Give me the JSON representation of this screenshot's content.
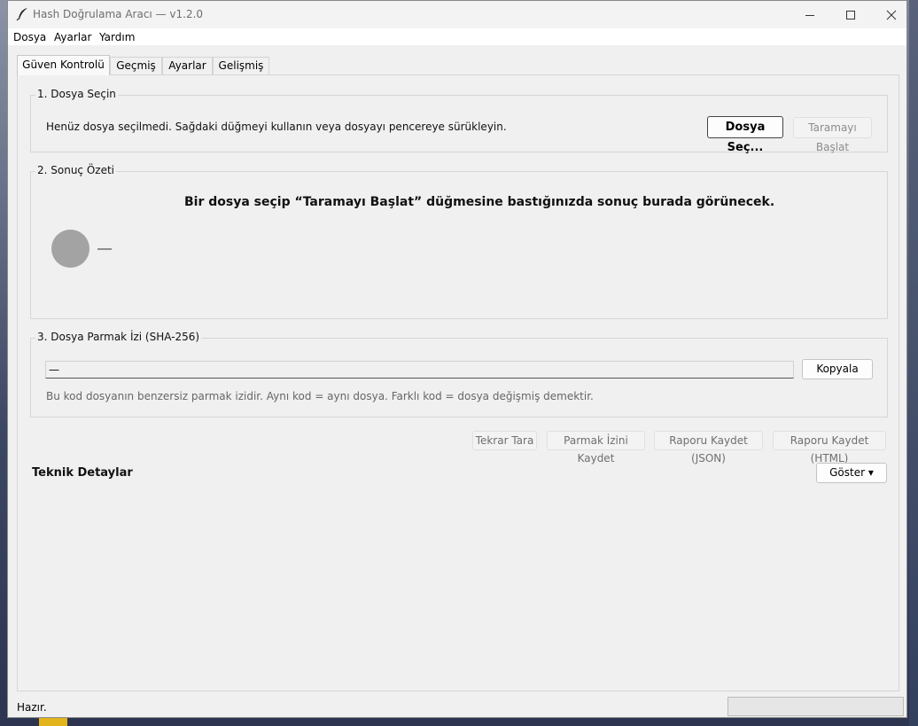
{
  "window": {
    "title": "Hash Doğrulama Aracı  —  v1.2.0"
  },
  "menu": {
    "items": [
      "Dosya",
      "Ayarlar",
      "Yardım"
    ]
  },
  "tabs": [
    "Güven Kontrolü",
    "Geçmiş",
    "Ayarlar",
    "Gelişmiş"
  ],
  "file_section": {
    "title": "1. Dosya Seçin",
    "description": "Henüz dosya seçilmedi. Sağdaki düğmeyi kullanın veya dosyayı pencereye sürükleyin.",
    "choose_button": "Dosya Seç...",
    "start_button": "Taramayı Başlat"
  },
  "summary_section": {
    "title": "2. Sonuç Özeti",
    "message": "Bir dosya seçip “Taramayı Başlat” düğmesine bastığınızda sonuç burada görünecek.",
    "indicator_color": "#a3a3a3"
  },
  "fingerprint_section": {
    "title": "3. Dosya Parmak İzi (SHA-256)",
    "hash_value": "—",
    "copy_button": "Kopyala",
    "help_text": "Bu kod dosyanın benzersiz parmak izidir. Aynı kod = aynı dosya. Farklı kod = dosya değişmiş demektir."
  },
  "actions": {
    "rescan": "Tekrar Tara",
    "save_fingerprint": "Parmak İzini Kaydet",
    "save_report_json": "Raporu Kaydet (JSON)",
    "save_report_html": "Raporu Kaydet (HTML)"
  },
  "technical": {
    "title": "Teknik Detaylar",
    "show_button": "Göster ▾"
  },
  "status": {
    "text": "Hazır.",
    "progress": 0
  }
}
